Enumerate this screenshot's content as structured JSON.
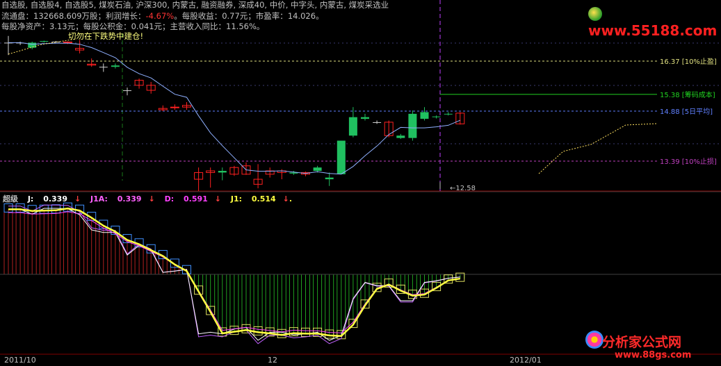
{
  "header": {
    "line1_parts": [
      "自选股, 自选股4, 自选股5, 煤炭石油, 沪深300, 内蒙古, 融资融券, 深成40, 中价, 中字头, 内蒙古, 煤炭采选业"
    ],
    "line2_label_a": "流通盘：",
    "line2_val_a": "132668.609万股",
    "line2_label_b": "；利润增长：",
    "line2_val_b": "-4.67%",
    "line2_label_c": "。每股收益：",
    "line2_val_c": "0.77元",
    "line2_label_d": "；市盈率：",
    "line2_val_d": "14.026",
    "line2_end": "。",
    "line3_label_a": "每股净资产：",
    "line3_val_a": "3.13元",
    "line3_label_b": "；每股公积金：",
    "line3_val_b": "0.041元",
    "line3_label_c": "；主营收入同比：",
    "line3_val_c": "11.56%",
    "line3_end": "。",
    "warning": "切勿在下跌势中建仓!"
  },
  "price_levels": [
    {
      "value": "16.37",
      "label": "[10%止盈]",
      "color": "#e0e080"
    },
    {
      "value": "15.38",
      "label": "[筹码成本]",
      "color": "#20d020"
    },
    {
      "value": "14.88",
      "label": "[5日平均]",
      "color": "#6080ff"
    },
    {
      "value": "13.39",
      "label": "[10%止损]",
      "color": "#c040c0"
    }
  ],
  "low_marker": "12.58",
  "indicator": {
    "name": "超级",
    "j_label": "J:",
    "j_val": "0.339",
    "j1a_label": "J1A:",
    "j1a_val": "0.339",
    "d_label": "D:",
    "d_val": "0.591",
    "j1_label": "J1:",
    "j1_val": "0.514"
  },
  "dates": [
    "2011/10",
    "12",
    "2012/01"
  ],
  "logos": {
    "top": "www.55188.com",
    "bottom_main": "分析家公式网",
    "bottom_sub": "www.88gs.com"
  },
  "colors": {
    "up": "#ff2020",
    "down": "#20c060",
    "neutral": "#d0d0d0",
    "ma": "#8fb0ff"
  },
  "chart_data": {
    "type": "candlestick",
    "candles": [
      {
        "o": 16.92,
        "h": 17.12,
        "l": 16.55,
        "c": 16.92
      },
      {
        "o": 16.92,
        "h": 16.95,
        "l": 16.85,
        "c": 16.92
      },
      {
        "o": 16.92,
        "h": 16.95,
        "l": 16.72,
        "c": 16.77
      },
      {
        "o": 16.97,
        "h": 16.98,
        "l": 16.92,
        "c": 16.95
      },
      {
        "o": 16.95,
        "h": 16.97,
        "l": 16.92,
        "c": 16.95
      },
      {
        "o": 16.92,
        "h": 16.96,
        "l": 16.88,
        "c": 16.94
      },
      {
        "o": 16.7,
        "h": 17.0,
        "l": 16.6,
        "c": 16.75
      },
      {
        "o": 16.25,
        "h": 16.45,
        "l": 16.2,
        "c": 16.28
      },
      {
        "o": 16.2,
        "h": 16.3,
        "l": 16.05,
        "c": 16.2
      },
      {
        "o": 16.24,
        "h": 16.3,
        "l": 16.15,
        "c": 16.2
      },
      {
        "o": 15.5,
        "h": 15.58,
        "l": 15.35,
        "c": 15.5
      },
      {
        "o": 15.65,
        "h": 15.85,
        "l": 15.55,
        "c": 15.8
      },
      {
        "o": 15.5,
        "h": 15.75,
        "l": 15.4,
        "c": 15.65
      },
      {
        "o": 14.92,
        "h": 15.05,
        "l": 14.88,
        "c": 14.96
      },
      {
        "o": 14.98,
        "h": 15.08,
        "l": 14.92,
        "c": 15.0
      },
      {
        "o": 15.0,
        "h": 15.15,
        "l": 14.92,
        "c": 15.05
      },
      {
        "o": 12.85,
        "h": 13.2,
        "l": 12.5,
        "c": 13.05
      },
      {
        "o": 13.05,
        "h": 13.2,
        "l": 12.6,
        "c": 13.1
      },
      {
        "o": 13.1,
        "h": 13.2,
        "l": 12.82,
        "c": 13.05
      },
      {
        "o": 13.0,
        "h": 13.25,
        "l": 12.95,
        "c": 13.2
      },
      {
        "o": 13.0,
        "h": 13.35,
        "l": 12.98,
        "c": 13.25
      },
      {
        "o": 12.7,
        "h": 13.3,
        "l": 12.58,
        "c": 12.85
      },
      {
        "o": 13.0,
        "h": 13.2,
        "l": 12.9,
        "c": 13.1
      },
      {
        "o": 13.05,
        "h": 13.15,
        "l": 12.85,
        "c": 13.1
      },
      {
        "o": 13.05,
        "h": 13.1,
        "l": 12.98,
        "c": 13.02
      },
      {
        "o": 13.0,
        "h": 13.08,
        "l": 12.94,
        "c": 13.05
      },
      {
        "o": 13.2,
        "h": 13.25,
        "l": 13.05,
        "c": 13.1
      },
      {
        "o": 12.9,
        "h": 13.05,
        "l": 12.65,
        "c": 12.85
      },
      {
        "o": 14.0,
        "h": 14.0,
        "l": 13.0,
        "c": 13.0
      },
      {
        "o": 14.7,
        "h": 15.0,
        "l": 14.1,
        "c": 14.15
      },
      {
        "o": 14.7,
        "h": 14.8,
        "l": 14.6,
        "c": 14.65
      },
      {
        "o": 14.55,
        "h": 14.6,
        "l": 14.5,
        "c": 14.55
      },
      {
        "o": 14.15,
        "h": 14.6,
        "l": 14.1,
        "c": 14.55
      },
      {
        "o": 14.15,
        "h": 14.2,
        "l": 14.05,
        "c": 14.08
      },
      {
        "o": 14.8,
        "h": 14.9,
        "l": 14.0,
        "c": 14.08
      },
      {
        "o": 14.85,
        "h": 15.0,
        "l": 14.6,
        "c": 14.65
      },
      {
        "o": 14.72,
        "h": 14.75,
        "l": 14.66,
        "c": 14.7
      },
      {
        "o": 14.8,
        "h": 14.85,
        "l": 14.75,
        "c": 14.78
      },
      {
        "o": 14.5,
        "h": 14.85,
        "l": 14.48,
        "c": 14.82
      }
    ]
  }
}
